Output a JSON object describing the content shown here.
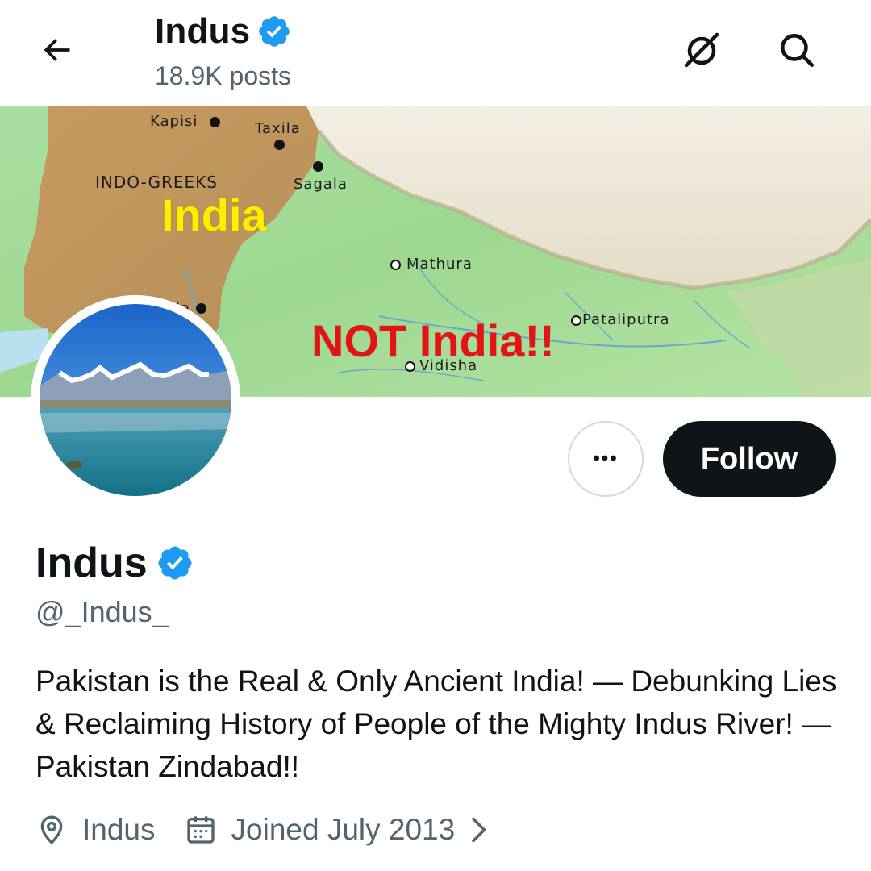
{
  "header": {
    "title": "Indus",
    "post_count": "18.9K posts"
  },
  "banner": {
    "map_labels": {
      "kapisi": "Kapisi",
      "taxila": "Taxila",
      "indo_greeks": "INDO-GREEKS",
      "sagala": "Sagala",
      "mathura": "Mathura",
      "la": "la",
      "pataliputra": "Pataliputra",
      "vidisha": "Vidisha"
    },
    "overlay_india": "India",
    "overlay_not_india": "NOT India!!"
  },
  "actions": {
    "more_label": "•••",
    "follow_label": "Follow"
  },
  "profile": {
    "display_name": "Indus",
    "handle": "@_Indus_",
    "bio": "Pakistan is the Real & Only Ancient India! — Debunking Lies & Reclaiming History of People of the Mighty Indus River! — Pakistan Zindabad!!",
    "location": "Indus",
    "joined": "Joined July 2013"
  },
  "colors": {
    "verified": "#1d9bf0",
    "secondary_text": "#536471",
    "follow_bg": "#0f1419"
  },
  "icons": [
    "back-arrow-icon",
    "verified-badge-icon",
    "grok-icon",
    "search-icon",
    "more-icon",
    "location-icon",
    "calendar-icon",
    "chevron-right-icon"
  ]
}
